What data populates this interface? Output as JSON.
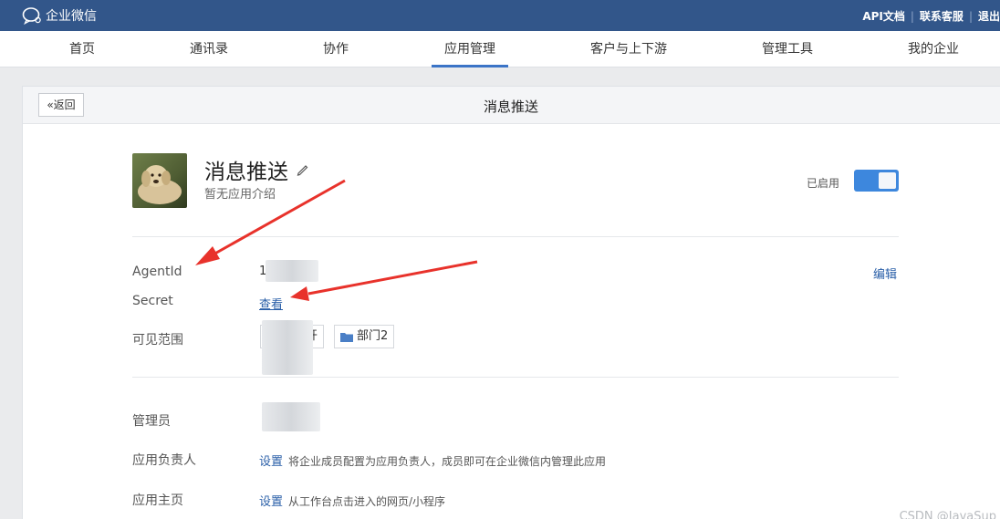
{
  "brand": {
    "name": "企业微信"
  },
  "toplinks": {
    "api_docs": "API文档",
    "contact": "联系客服",
    "logout": "退出"
  },
  "nav": {
    "items": [
      {
        "label": "首页"
      },
      {
        "label": "通讯录"
      },
      {
        "label": "协作"
      },
      {
        "label": "应用管理"
      },
      {
        "label": "客户与上下游"
      },
      {
        "label": "管理工具"
      },
      {
        "label": "我的企业"
      }
    ],
    "active": "应用管理"
  },
  "panel": {
    "back_label": "«返回",
    "title": "消息推送"
  },
  "app": {
    "name": "消息推送",
    "description": "暂无应用介绍",
    "enabled_label": "已启用",
    "enabled": true
  },
  "details": {
    "agentid_label": "AgentId",
    "agentid_prefix": "1",
    "secret_label": "Secret",
    "secret_action": "查看",
    "edit_label": "编辑",
    "scope_label": "可见范围",
    "scope_tags": [
      {
        "label": "开"
      },
      {
        "label": "部门2"
      }
    ]
  },
  "admin": {
    "admin_label": "管理员",
    "owner_label": "应用负责人",
    "owner_action": "设置",
    "owner_hint": "将企业成员配置为应用负责人，成员即可在企业微信内管理此应用",
    "homepage_label": "应用主页",
    "homepage_action": "设置",
    "homepage_hint": "从工作台点击进入的网页/小程序"
  },
  "watermark": "CSDN @JavaSup",
  "colors": {
    "topbar": "#32568a",
    "accent": "#3b74c7",
    "link": "#2a5fa8",
    "toggle": "#3d87dd",
    "arrow": "#e8322b"
  }
}
